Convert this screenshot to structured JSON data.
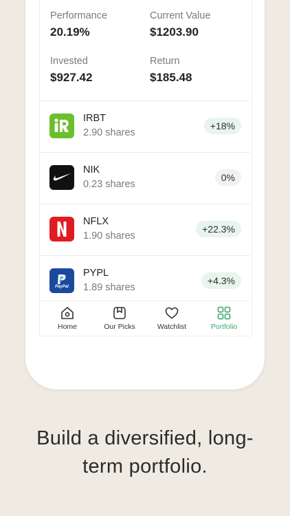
{
  "stats": {
    "performance": {
      "label": "Performance",
      "value": "20.19%"
    },
    "current_value": {
      "label": "Current Value",
      "value": "$1203.90"
    },
    "invested": {
      "label": "Invested",
      "value": "$927.42"
    },
    "return": {
      "label": "Return",
      "value": "$185.48"
    }
  },
  "holdings": [
    {
      "ticker": "IRBT",
      "shares": "2.90 shares",
      "change": "+18%"
    },
    {
      "ticker": "NIK",
      "shares": "0.23 shares",
      "change": "0%"
    },
    {
      "ticker": "NFLX",
      "shares": "1.90 shares",
      "change": "+22.3%"
    },
    {
      "ticker": "PYPL",
      "shares": "1.89 shares",
      "change": "+4.3%",
      "logo_text": "PayPal"
    }
  ],
  "tabs": [
    {
      "label": "Home",
      "icon": "home-icon"
    },
    {
      "label": "Our Picks",
      "icon": "picks-icon"
    },
    {
      "label": "Watchlist",
      "icon": "heart-icon"
    },
    {
      "label": "Portfolio",
      "icon": "grid-icon",
      "active": true
    }
  ],
  "headline": {
    "line1": "Build a diversified, long-",
    "line2": "term portfolio."
  },
  "colors": {
    "accent": "#3aa76d",
    "background": "#efebe2",
    "irbt": "#6abf2b",
    "nik": "#111111",
    "nflx": "#e11b22",
    "pypl": "#1a4a9c"
  }
}
